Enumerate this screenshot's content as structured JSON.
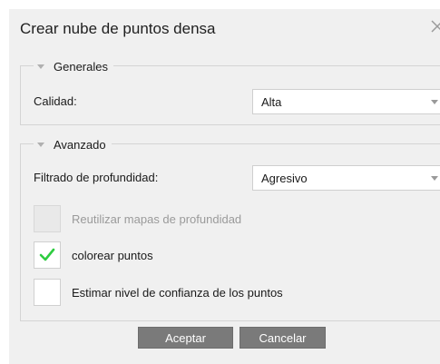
{
  "dialog": {
    "title": "Crear nube de puntos densa",
    "close_icon": "close-icon"
  },
  "general": {
    "legend": "Generales",
    "quality_label": "Calidad:",
    "quality_value": "Alta"
  },
  "advanced": {
    "legend": "Avanzado",
    "depth_filter_label": "Filtrado de profundidad:",
    "depth_filter_value": "Agresivo",
    "reuse_depth_maps": {
      "label": "Reutilizar mapas de profundidad",
      "checked": false,
      "enabled": false
    },
    "color_points": {
      "label": "colorear puntos",
      "checked": true,
      "enabled": true
    },
    "estimate_confidence": {
      "label": "Estimar nivel de confianza de los puntos",
      "checked": false,
      "enabled": true
    }
  },
  "buttons": {
    "ok": "Aceptar",
    "cancel": "Cancelar"
  },
  "colors": {
    "dialog_bg": "#f0f0f0",
    "button_bg": "#7a7a7a",
    "check_green": "#2ecc40"
  }
}
